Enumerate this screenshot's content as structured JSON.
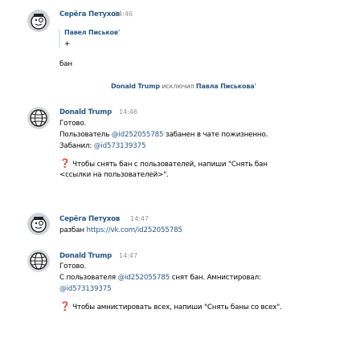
{
  "messages": [
    {
      "author": "Серёга Петухов",
      "time": "14:46",
      "reply_author": "Павел Письков'",
      "reply_text": "+",
      "text": "бан"
    },
    {
      "author": "Donald Trump",
      "time": "14:46",
      "line1": "Готово.",
      "line2_pre": "Пользователь ",
      "line2_link": "@id252055785",
      "line2_post": " забанен в чате пожизненно.",
      "line3_pre": "Забанил: ",
      "line3_link": "@id573139375",
      "hint_line1": "Чтобы снять бан с пользователей, напиши \"Снять бан",
      "hint_line2": "<ссылки на пользователей>\"."
    },
    {
      "author": "Серёга Петухов",
      "time": "14:47",
      "text_pre": "разбан ",
      "text_link": "https://vk.com/id252055785"
    },
    {
      "author": "Donald Trump",
      "time": "14:47",
      "line1": "Готово.",
      "line2_pre": "С пользователя ",
      "line2_link": "@id252055785",
      "line2_post": " снят бан. Амнистировал:",
      "line3_link": "@id573139375",
      "hint_line1": "Чтобы амнистировать всех, напиши \"Снять баны со всех\"."
    }
  ],
  "service_message": {
    "actor": "Donald Trump",
    "action": "исключил",
    "target": "Павла Писькова'"
  },
  "colors": {
    "name": "#2a5885",
    "link": "#2a5885",
    "time": "#939393",
    "question_icon": "#e64646"
  },
  "icons": {
    "question": "❓"
  }
}
